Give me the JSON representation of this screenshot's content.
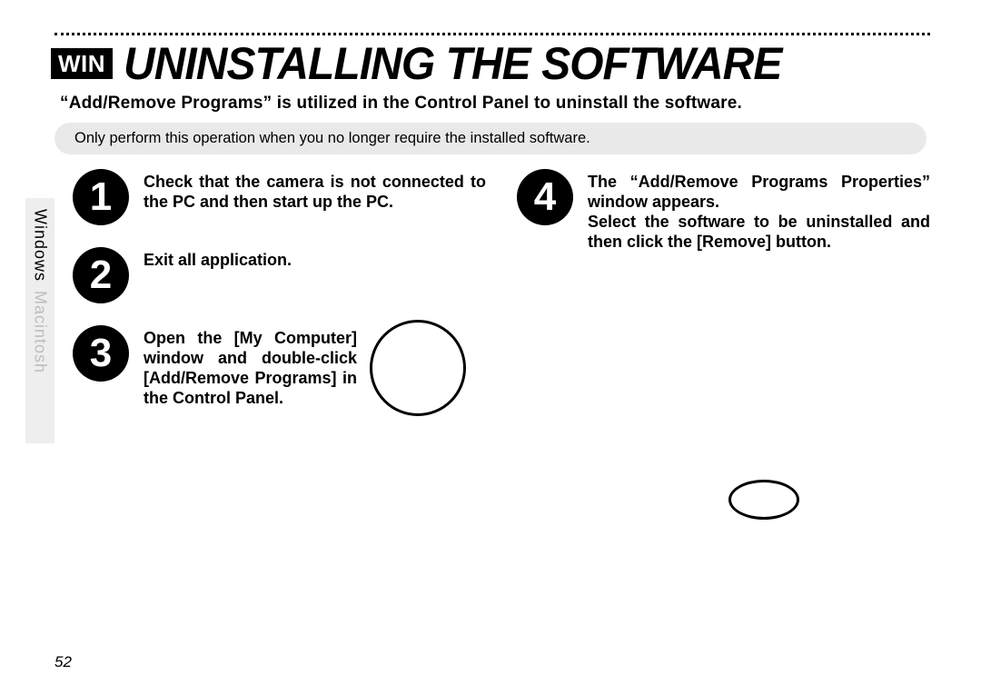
{
  "badge": "WIN",
  "title": "UNINSTALLING THE SOFTWARE",
  "subtitle": "“Add/Remove Programs” is utilized in the Control Panel to uninstall the software.",
  "note": "Only perform this operation when you no longer require the installed software.",
  "sidebar": {
    "windows": "Windows",
    "macintosh": "Macintosh"
  },
  "steps": {
    "s1": {
      "num": "1",
      "text": "Check that the camera is not connected to the PC and then start up the PC."
    },
    "s2": {
      "num": "2",
      "text": "Exit all application."
    },
    "s3": {
      "num": "3",
      "text": "Open the [My Computer] window and double-click [Add/Remove Programs] in the Control Panel."
    },
    "s4": {
      "num": "4",
      "text": "The “Add/Remove Programs Properties” window appears.\nSelect the software to be uninstalled and then click the [Remove] button."
    }
  },
  "pageNumber": "52"
}
